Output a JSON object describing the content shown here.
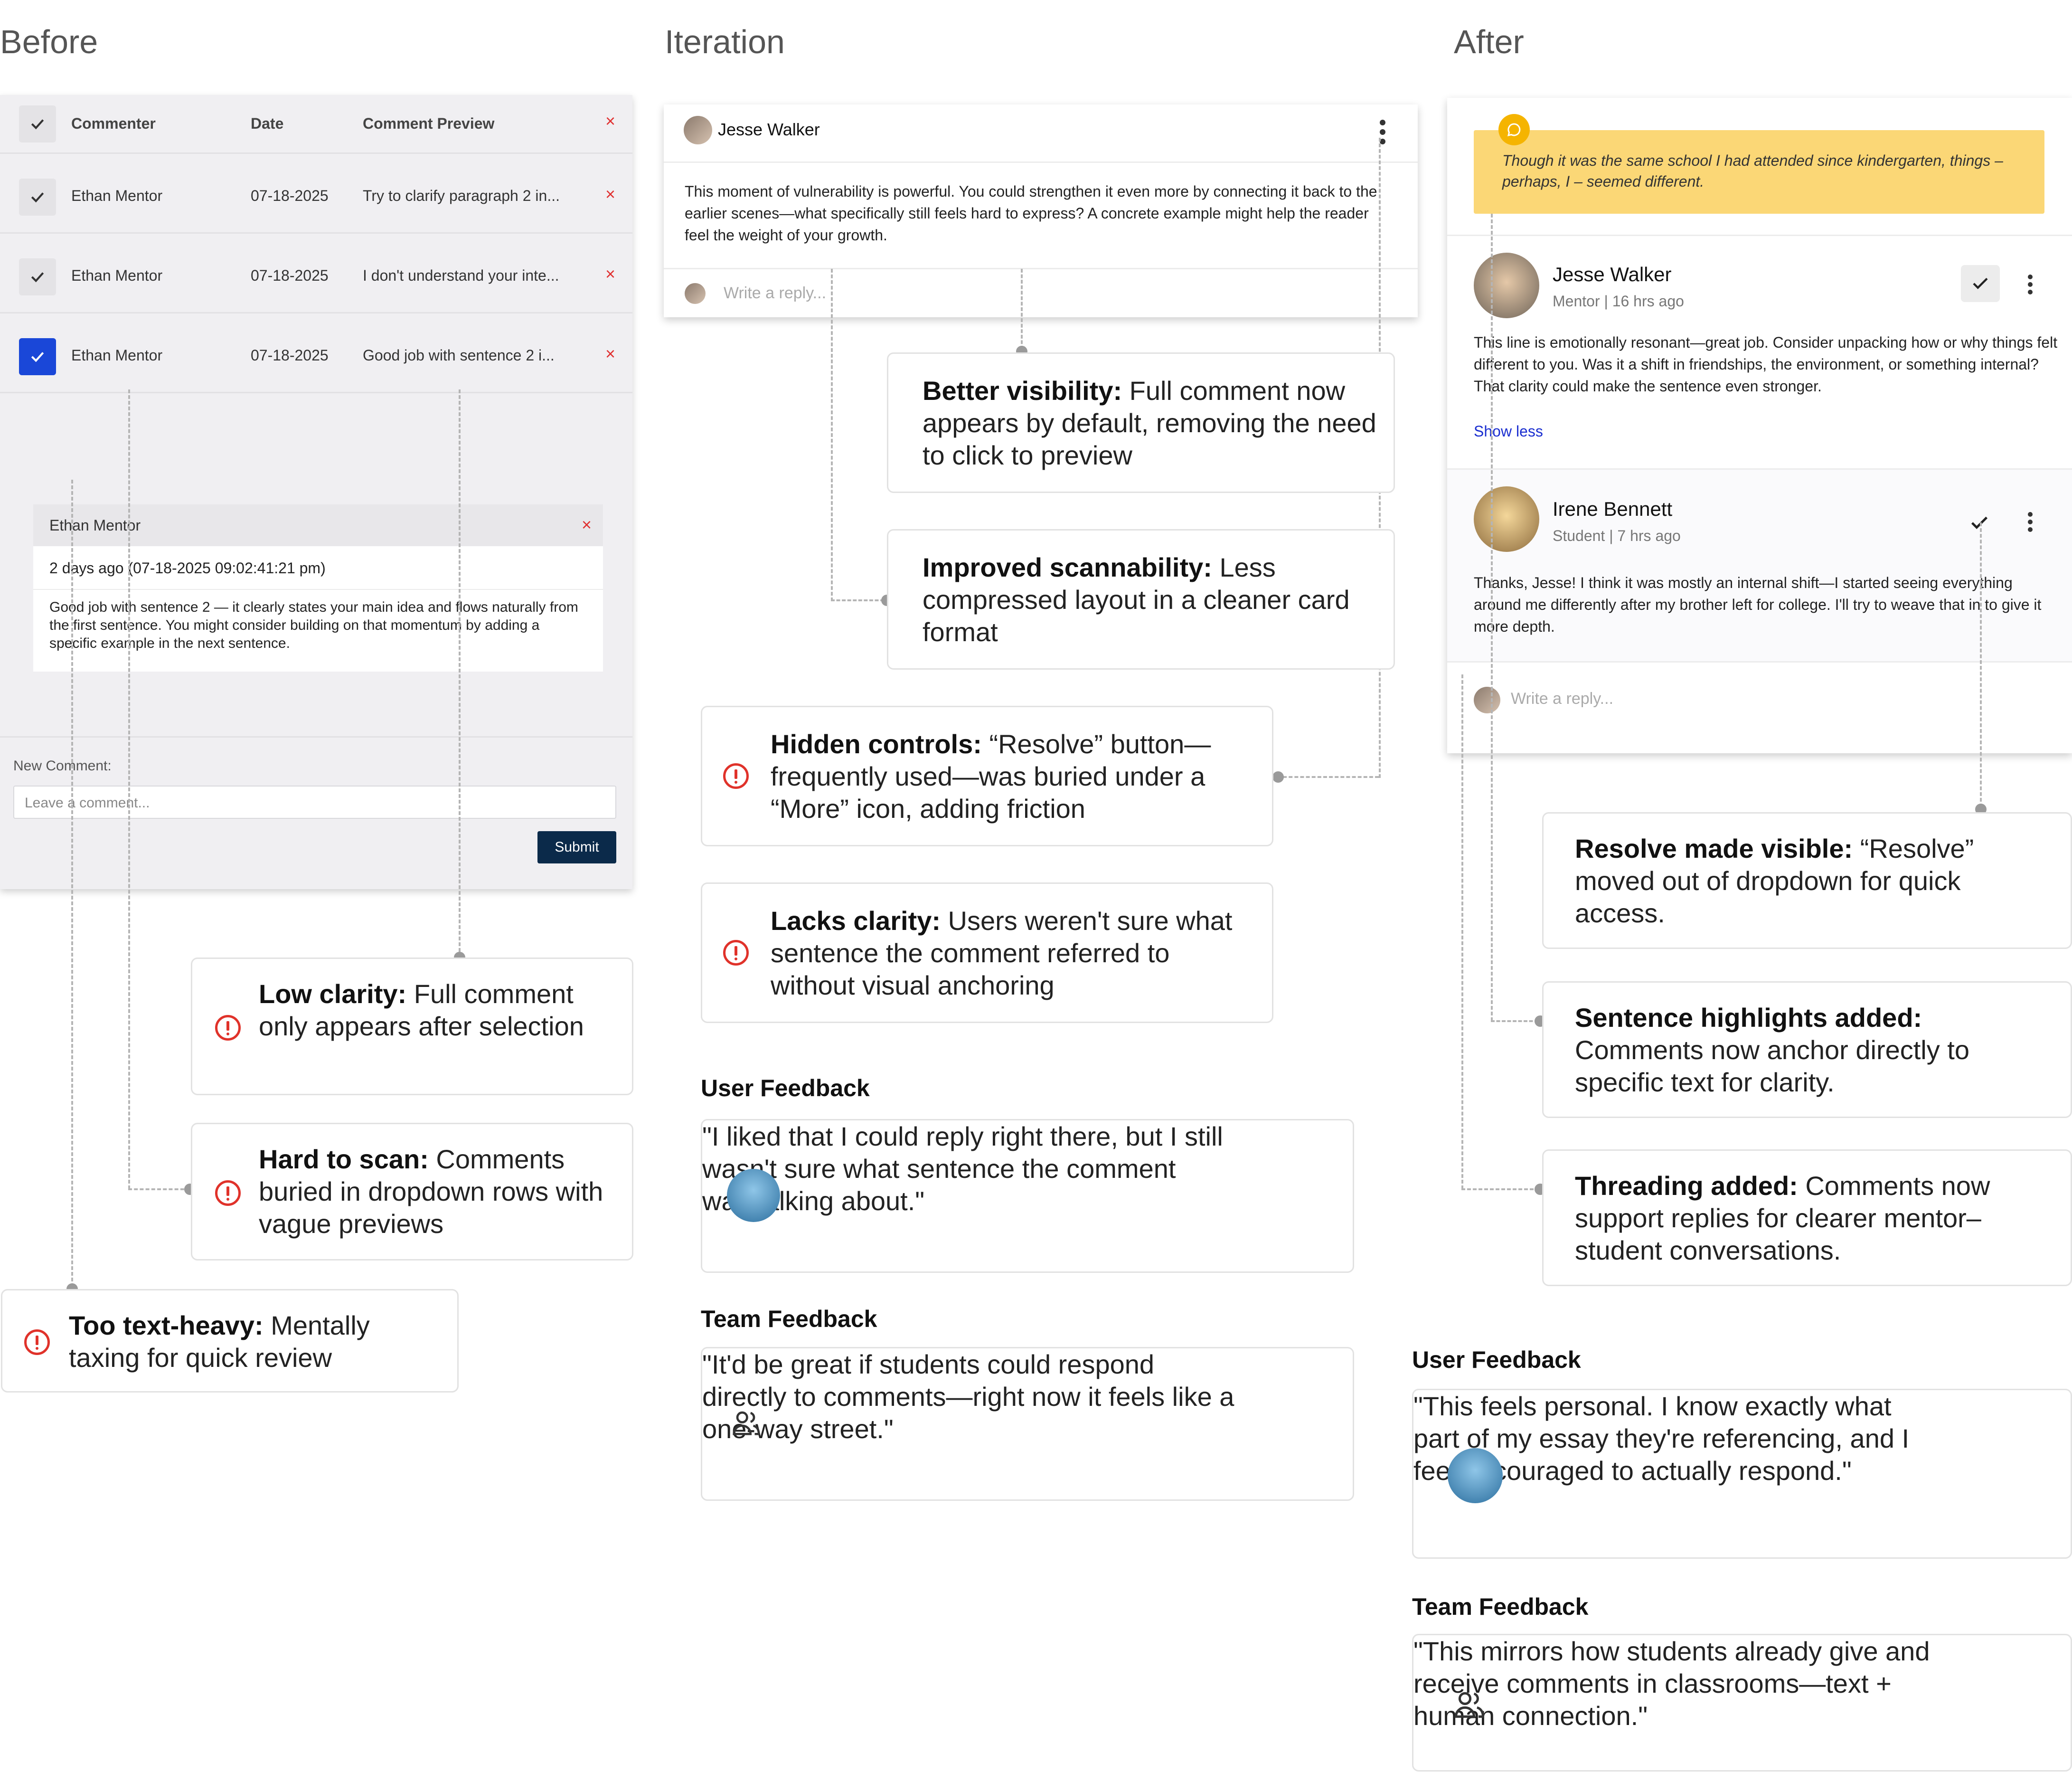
{
  "columns": {
    "before": "Before",
    "iteration": "Iteration",
    "after": "After"
  },
  "before": {
    "table_headers": [
      "Commenter",
      "Date",
      "Comment Preview"
    ],
    "rows": [
      {
        "commenter": "Ethan Mentor",
        "date": "07-18-2025",
        "preview": "Try to clarify paragraph 2 in...",
        "checked": false
      },
      {
        "commenter": "Ethan Mentor",
        "date": "07-18-2025",
        "preview": "I don't understand your inte...",
        "checked": false
      },
      {
        "commenter": "Ethan Mentor",
        "date": "07-18-2025",
        "preview": "Good job with sentence 2 i...",
        "checked": true
      }
    ],
    "close_glyph": "×",
    "detail": {
      "author": "Ethan Mentor",
      "time": "2 days ago (07-18-2025 09:02:41:21 pm)",
      "body": "Good job with sentence 2 — it clearly states your main idea and flows naturally from the first sentence. You might consider building on that momentum by adding a specific example in the next sentence."
    },
    "new_comment_label": "New Comment:",
    "input_placeholder": "Leave a comment...",
    "submit_label": "Submit",
    "callouts": [
      {
        "title": "Low clarity:",
        "text": "Full comment only appears after selection"
      },
      {
        "title": "Hard to scan:",
        "text": "Comments buried in dropdown rows with vague previews"
      },
      {
        "title": "Too text-heavy:",
        "text": "Mentally taxing for quick review"
      }
    ]
  },
  "iteration": {
    "card": {
      "author": "Jesse Walker",
      "body": "This moment of vulnerability is powerful. You could strengthen it even more by connecting it back to the earlier scenes—what specifically still feels hard to express? A concrete example might help the reader feel the weight of your growth.",
      "reply_placeholder": "Write a reply..."
    },
    "callouts": [
      {
        "title": "Better visibility:",
        "text": "Full comment now appears by default, removing the need to click to preview"
      },
      {
        "title": "Improved scannability:",
        "text": "Less compressed layout in a cleaner card format"
      },
      {
        "title": "Hidden controls:",
        "text": "“Resolve” button—frequently used—was buried under a “More” icon, adding friction"
      },
      {
        "title": "Lacks clarity:",
        "text": "Users weren't sure what sentence the comment referred to without visual anchoring"
      }
    ],
    "user_feedback_title": "User Feedback",
    "user_feedback": "\"I liked that I could reply right there, but I still wasn't sure what sentence the comment was talking about.\"",
    "team_feedback_title": "Team Feedback",
    "team_feedback": "\"It'd be great if students could respond directly to comments—right now it feels like a one-way street.\""
  },
  "after": {
    "highlight": "Though it was the same school I had attended since kindergarten, things – perhaps, I – seemed different.",
    "comment1": {
      "author": "Jesse Walker",
      "meta": "Mentor | 16 hrs ago",
      "body": "This line is emotionally resonant—great job. Consider unpacking how or why things felt different to you. Was it a shift in friendships, the environment, or something internal? That clarity could make the sentence even stronger.",
      "show_less": "Show less"
    },
    "comment2": {
      "author": "Irene Bennett",
      "meta": "Student | 7 hrs ago",
      "body": "Thanks, Jesse! I think it was mostly an internal shift—I started seeing everything around me differently after my brother left for college. I'll try to weave that in to give it more depth."
    },
    "reply_placeholder": "Write a reply...",
    "callouts": [
      {
        "title": "Resolve made visible:",
        "text": "“Resolve” moved out of dropdown for quick access."
      },
      {
        "title": "Sentence highlights added:",
        "text": "Comments now anchor directly to specific text for clarity."
      },
      {
        "title": "Threading added:",
        "text": "Comments now support replies for clearer mentor–student conversations."
      }
    ],
    "user_feedback_title": "User Feedback",
    "user_feedback": "\"This feels personal. I know exactly what part of my essay they're referencing, and I feel encouraged to actually respond.\"",
    "team_feedback_title": "Team Feedback",
    "team_feedback": "\"This mirrors how students already give and receive comments in classrooms—text + human connection.\""
  },
  "colors": {
    "warning": "#e0322a",
    "submit": "#0b2a4a",
    "highlight": "#fbd776",
    "checkbox_active": "#1a47d8"
  }
}
